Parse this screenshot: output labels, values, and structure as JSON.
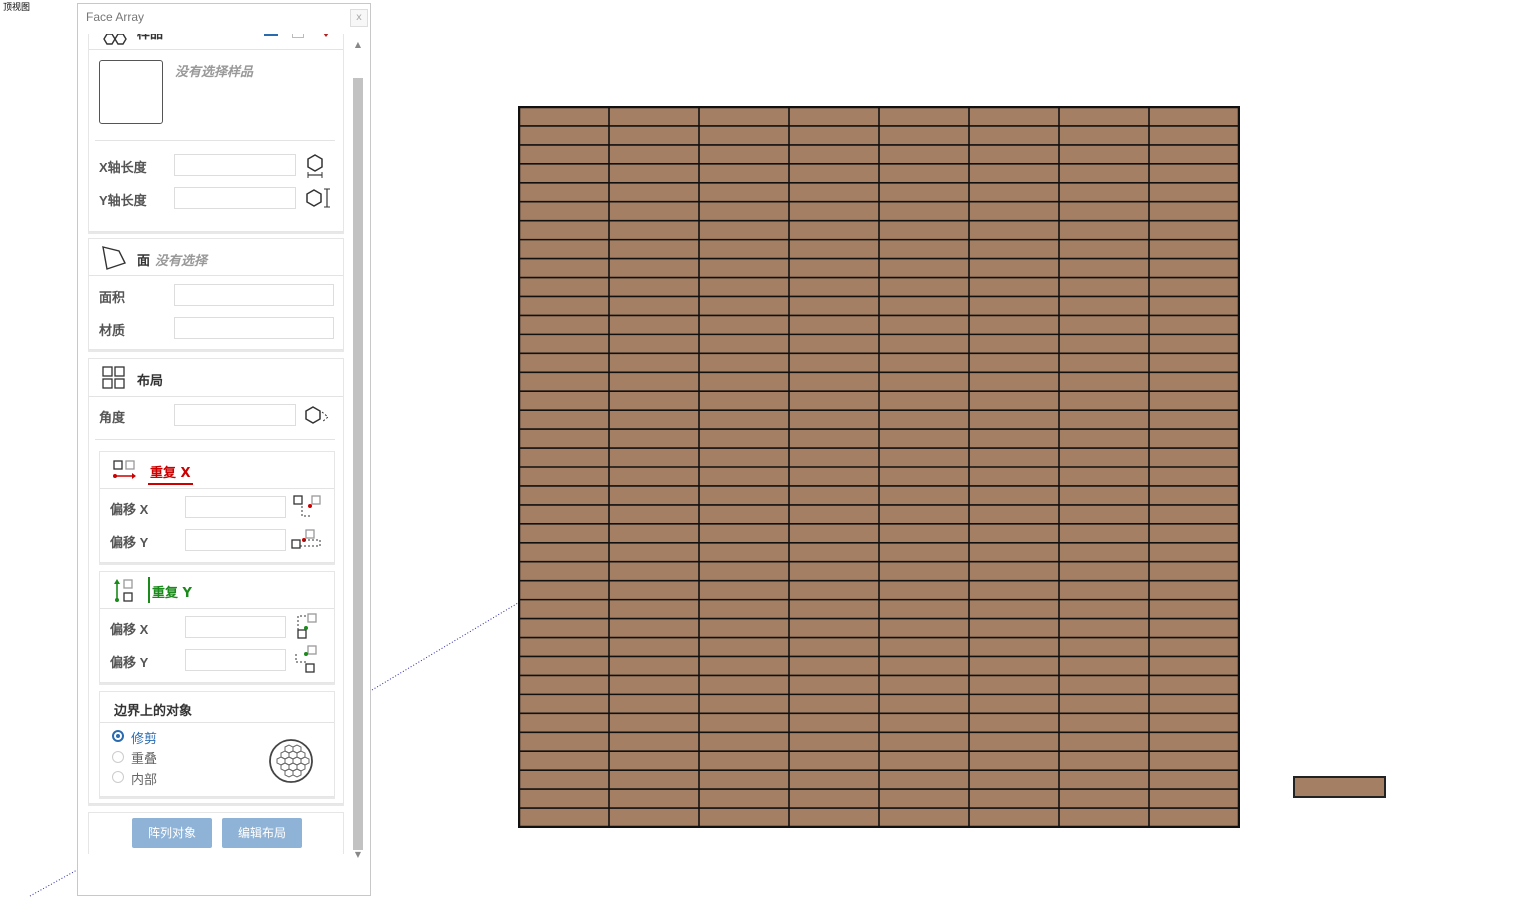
{
  "viewport": {
    "view_name": "顶视图"
  },
  "panel": {
    "title": "Face Array",
    "close_label": "x",
    "sample": {
      "title": "样品",
      "no_selection": "没有选择样品",
      "x_length_label": "X轴长度",
      "x_length_value": "",
      "y_length_label": "Y轴长度",
      "y_length_value": ""
    },
    "face": {
      "title": "面",
      "no_selection": "没有选择",
      "area_label": "面积",
      "area_value": "",
      "material_label": "材质",
      "material_value": ""
    },
    "layout": {
      "title": "布局",
      "angle_label": "角度",
      "angle_value": "",
      "repeat_x": {
        "title": "重复 X",
        "offset_x_label": "偏移 X",
        "offset_x_value": "",
        "offset_y_label": "偏移 Y",
        "offset_y_value": ""
      },
      "repeat_y": {
        "title": "重复 Y",
        "offset_x_label": "偏移 X",
        "offset_x_value": "",
        "offset_y_label": "偏移 Y",
        "offset_y_value": ""
      }
    },
    "boundary": {
      "title": "边界上的对象",
      "options": [
        "修剪",
        "重叠",
        "内部"
      ],
      "selected": "修剪"
    },
    "buttons": {
      "array_label": "阵列对象",
      "edit_label": "编辑布局"
    }
  },
  "colors": {
    "plank": "#a47f64",
    "grout": "#111111",
    "repeat_x_accent": "#cc0000",
    "repeat_y_accent": "#1a8a1a",
    "button_bg": "#8fb3d6",
    "radio_selected": "#2a6bb0"
  },
  "tile_grid": {
    "columns": 8,
    "rows": 38
  }
}
